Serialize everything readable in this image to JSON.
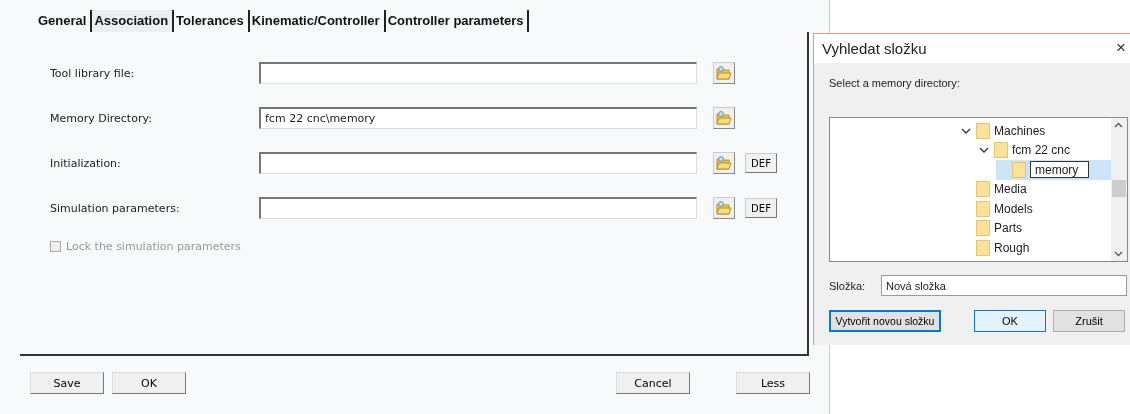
{
  "tabs": [
    {
      "label": "General",
      "selected": false
    },
    {
      "label": "Association",
      "selected": true
    },
    {
      "label": "Tolerances",
      "selected": false
    },
    {
      "label": "Kinematic/Controller",
      "selected": false
    },
    {
      "label": "Controller parameters",
      "selected": false
    }
  ],
  "fields": [
    {
      "label": "Tool library file:"
    },
    {
      "label": "Memory Directory:",
      "value": "fcm 22 cnc\\memory"
    },
    {
      "label": "Initialization:",
      "def_button": "DEF"
    },
    {
      "label": "Simulation parameters:",
      "def_button": "DEF"
    }
  ],
  "lock_checkbox": {
    "label": "Lock the simulation parameters",
    "checked": false,
    "disabled": true
  },
  "left_buttons": [
    "Save",
    "OK"
  ],
  "right_buttons": [
    "Cancel",
    "Less"
  ],
  "dialog": {
    "title": "Vyhledat složku",
    "close": "×",
    "instruction": "Select a memory directory:",
    "tree": [
      {
        "label": "Machines",
        "expanded": true,
        "selected": false,
        "children": [
          {
            "label": "fcm 22 cnc",
            "expanded": true,
            "selected": false,
            "children": [
              {
                "label": "memory",
                "selected": true,
                "editing": true
              }
            ]
          }
        ]
      },
      {
        "label": "Media",
        "selected": false
      },
      {
        "label": "Models",
        "selected": false
      },
      {
        "label": "Parts",
        "selected": false
      },
      {
        "label": "Rough",
        "selected": false
      }
    ],
    "folder_label": "Složka:",
    "folder_value": "Nová složka",
    "buttons": [
      {
        "label": "Vytvořit novou složku",
        "kind": "focused"
      },
      {
        "label": "OK",
        "kind": "default"
      },
      {
        "label": "Zrušit",
        "kind": "normal"
      }
    ]
  }
}
